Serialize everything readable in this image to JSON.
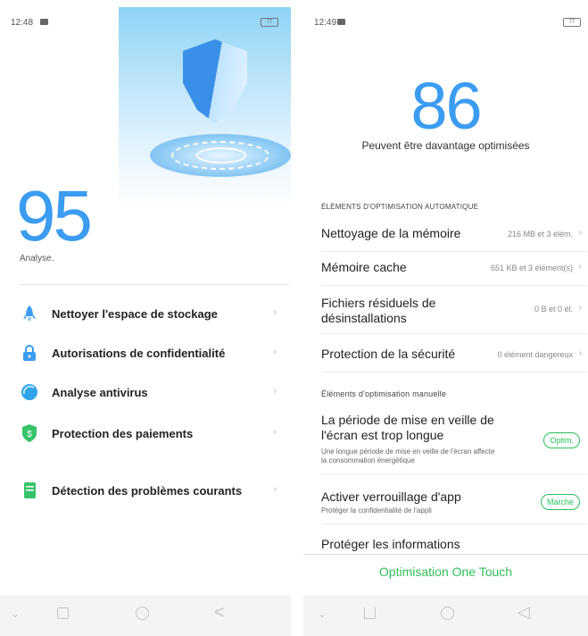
{
  "left": {
    "status": {
      "time": "12:48",
      "battery": "77"
    },
    "score": "95",
    "analysis_label": "Analyse.",
    "menu": [
      {
        "label": "Nettoyer l'espace de stockage",
        "icon": "rocket-icon",
        "color": "#3b9cf0"
      },
      {
        "label": "Autorisations de confidentialité",
        "icon": "lock-icon",
        "color": "#3b9cf0"
      },
      {
        "label": "Analyse antivirus",
        "icon": "scan-icon",
        "color": "#2fa4e8"
      },
      {
        "label": "Protection des paiements",
        "icon": "dollar-shield-icon",
        "color": "#35c46a"
      },
      {
        "label": "Détection des problèmes courants",
        "icon": "document-icon",
        "color": "#35c46a"
      }
    ],
    "chevron": "›"
  },
  "right": {
    "status": {
      "time": "12:49",
      "battery": "77"
    },
    "score": "86",
    "score_subtitle": "Peuvent être davantage optimisées",
    "auto_section": "ÉLÉMENTS D'OPTIMISATION AUTOMATIQUE",
    "auto_items": [
      {
        "label": "Nettoyage de la mémoire",
        "value": "216 MB et 3 élém."
      },
      {
        "label": "Mémoire cache",
        "value": "651 KB et 3 élément(s)"
      },
      {
        "label": "Fichiers résiduels de désinstallations",
        "value": "0 B et 0 él."
      },
      {
        "label": "Protection de la sécurité",
        "value": "0 élément dangereux"
      }
    ],
    "manual_section": "Éléments d'optimisation manuelle",
    "manual_items": [
      {
        "label": "La période de mise en veille de l'écran est trop longue",
        "desc": "Une longue période de mise en veille de l'écran affecte la consommation énergétique",
        "action": "Optim."
      },
      {
        "label": "Activer verrouillage d'app",
        "desc": "Protéger la confidentialité de l'appli",
        "action": "Marche"
      },
      {
        "label": "Protéger les informations"
      }
    ],
    "one_touch": "Optimisation One Touch",
    "chevron": "›"
  },
  "colors": {
    "accent_blue": "#3b9cf0",
    "accent_green": "#2fbf5a"
  }
}
